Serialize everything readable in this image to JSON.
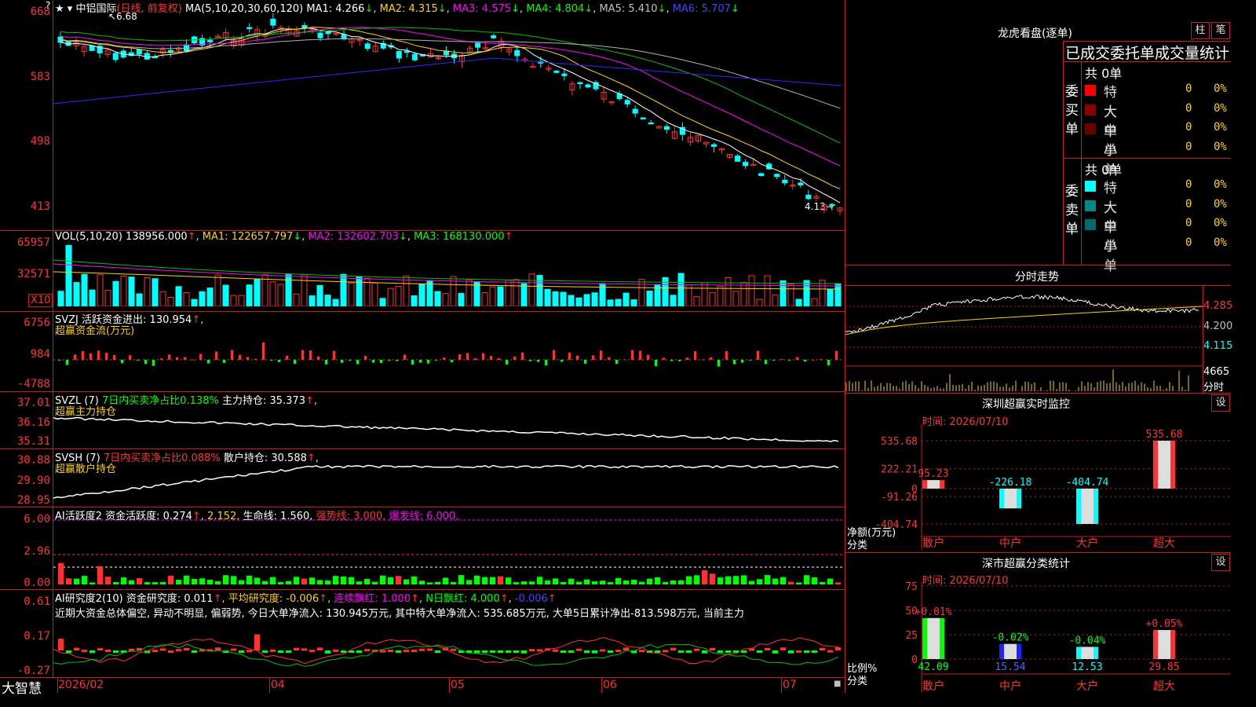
{
  "header": {
    "stock_name": "中铝国际",
    "mode": "(日线, 前复权)",
    "ma_label": "MA(5,10,20,30,60,120)",
    "ma1": "MA1: 4.266",
    "ma2": "MA2: 4.315",
    "ma3": "MA3: 4.575",
    "ma4": "MA4: 4.804",
    "ma5": "MA5: 5.410",
    "ma6": "MA6: 5.707",
    "high_marker": "6.68",
    "low_marker": "4.13"
  },
  "price_axis": [
    "668",
    "583",
    "498",
    "413"
  ],
  "vol": {
    "title": "VOL(5,10,20)",
    "value": "138956.000",
    "ma1": "MA1: 122657.797",
    "ma2": "MA2: 132602.703",
    "ma3": "MA3: 168130.000",
    "axis": [
      "65957",
      "32571"
    ],
    "unit": "X10"
  },
  "svzj": {
    "title": "SVZJ",
    "label": "活跃资金进出: 130.954",
    "sub": "超赢资金流(万元)",
    "axis": [
      "6756",
      "984",
      "-4788"
    ]
  },
  "svzl": {
    "title": "SVZL (7)",
    "label1": "7日内买卖净占比0.138%",
    "label2": "主力持仓: 35.373",
    "sub": "超赢主力持仓",
    "axis": [
      "37.01",
      "36.16",
      "35.31"
    ]
  },
  "svsh": {
    "title": "SVSH (7)",
    "label1": "7日内买卖净占比0.088%",
    "label2": "散户持仓: 30.588",
    "sub": "超赢散户持仓",
    "axis": [
      "30.88",
      "29.90",
      "28.95"
    ]
  },
  "ai1": {
    "title": "AI活跃度2",
    "label1": "资金活跃度: 0.274",
    "label2": "2.152,",
    "label3": "生命线: 1.560,",
    "label4": "强势线: 3.000,",
    "label5": "爆发线: 6.000,",
    "axis": [
      "6.00",
      "2.96",
      "0.00"
    ]
  },
  "ai2": {
    "title": "AI研究度2(10)",
    "label1": "资金研究度: 0.011",
    "label2": "平均研究度: -0.006",
    "label3": "连续飘红: 1.000",
    "label4": "N日飘红: 4.000",
    "label5": "-0.006",
    "comment": "近期大资金总体偏空, 异动不明显, 偏弱势, 今日大单净流入: 130.945万元, 其中特大单净流入: 535.685万元, 大单5日累计净出-813.598万元, 当前主力",
    "axis": [
      "0.61",
      "0.17",
      "-0.27"
    ]
  },
  "xaxis": {
    "logo": "大智慧",
    "dates": [
      "2026/02",
      "04",
      "05",
      "06",
      "07"
    ]
  },
  "right": {
    "title": "龙虎看盘(逐单)",
    "btn1": "柱",
    "btn2": "笔",
    "stat_title": "已成交委托单成交量统计",
    "buy_label": "委买单",
    "sell_label": "委卖单",
    "buy_total": "共 0单",
    "sell_total": "共 0单",
    "buy_rows": [
      {
        "name": "特大",
        "count": "0",
        "pct": "0%",
        "color": "#ff0000"
      },
      {
        "name": "大单",
        "count": "0",
        "pct": "0%",
        "color": "#8b0000"
      },
      {
        "name": "中单",
        "count": "0",
        "pct": "0%",
        "color": "#6b0000"
      },
      {
        "name": "小单",
        "count": "0",
        "pct": "0%",
        "color": "#000000"
      }
    ],
    "sell_rows": [
      {
        "name": "特大",
        "count": "0",
        "pct": "0%",
        "color": "#00ffff"
      },
      {
        "name": "大单",
        "count": "0",
        "pct": "0%",
        "color": "#008b8b"
      },
      {
        "name": "中单",
        "count": "0",
        "pct": "0%",
        "color": "#006b6b"
      },
      {
        "name": "小单",
        "count": "0",
        "pct": "0%",
        "color": "#000000"
      }
    ],
    "intraday_title": "分时走势",
    "intraday_axis": [
      "4.285",
      "4.200",
      "4.115"
    ],
    "intraday_vol": "4665",
    "intraday_vol_label": "分时",
    "monitor_title": "深圳超赢实时监控",
    "monitor_btn": "设",
    "monitor_time": "时间: 2026/07/10",
    "monitor_axis": [
      "535.68",
      "222.21",
      "0",
      "-91.26",
      "-404.74"
    ],
    "monitor_label1": "净额(万元)",
    "monitor_label2": "分类",
    "classify_title": "深市超赢分类统计",
    "classify_btn": "设",
    "classify_time": "时间: 2026/07/10",
    "classify_axis": [
      "75",
      "50",
      "25",
      "0"
    ],
    "classify_label1": "比例%",
    "classify_label2": "分类"
  },
  "chart_data": [
    {
      "type": "bar",
      "title": "深圳超赢实时监控",
      "categories": [
        "散户",
        "中户",
        "大户",
        "超大"
      ],
      "values": [
        95.23,
        -226.18,
        -404.74,
        535.68
      ],
      "ylabel": "净额(万元)",
      "ylim": [
        -404.74,
        535.68
      ]
    },
    {
      "type": "bar",
      "title": "深市超赢分类统计",
      "categories": [
        "散户",
        "中户",
        "大户",
        "超大"
      ],
      "values": [
        42.09,
        15.54,
        12.53,
        29.85
      ],
      "changes": [
        "+0.01%",
        "-0.02%",
        "-0.04%",
        "+0.05%"
      ],
      "ylabel": "比例%",
      "ylim": [
        0,
        75
      ]
    }
  ]
}
